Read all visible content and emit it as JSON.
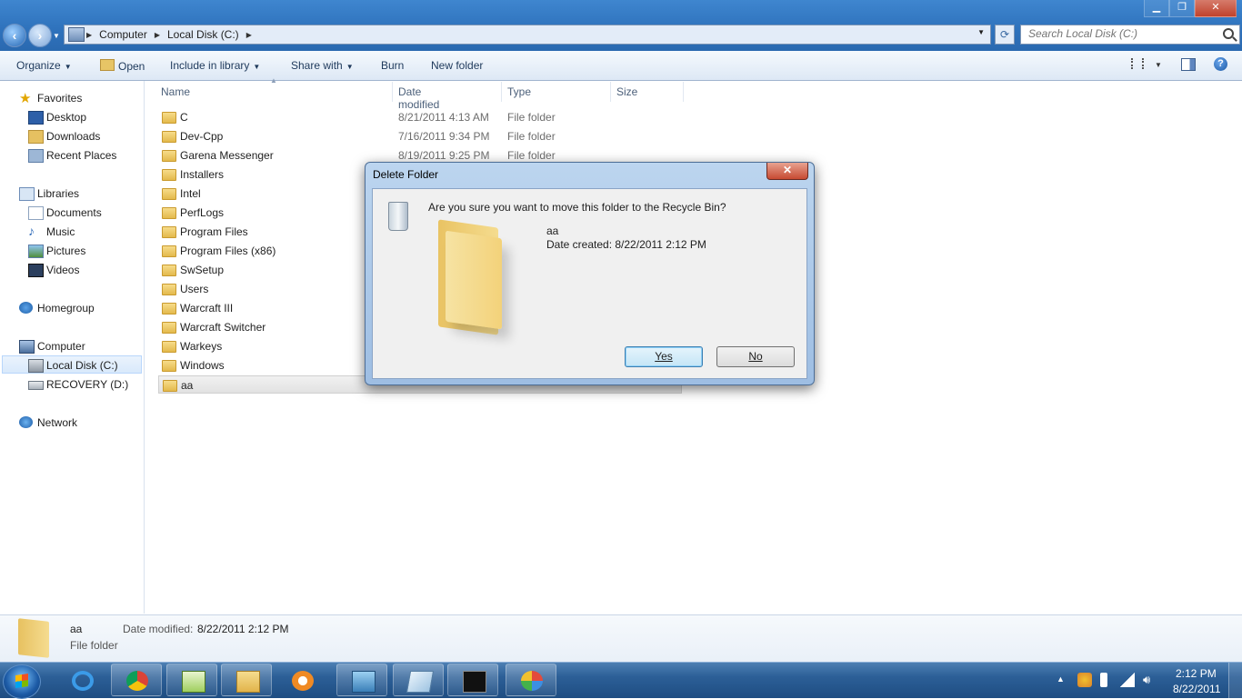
{
  "window": {
    "buttons": {
      "minimize": "▁",
      "restore": "❐",
      "close": "✕"
    },
    "breadcrumbs": [
      "Computer",
      "Local Disk (C:)"
    ],
    "search_placeholder": "Search Local Disk (C:)"
  },
  "toolbar": {
    "organize": "Organize",
    "open": "Open",
    "include": "Include in library",
    "share": "Share with",
    "burn": "Burn",
    "new_folder": "New folder"
  },
  "nav": {
    "favorites": "Favorites",
    "desktop": "Desktop",
    "downloads": "Downloads",
    "recent": "Recent Places",
    "libraries": "Libraries",
    "documents": "Documents",
    "music": "Music",
    "pictures": "Pictures",
    "videos": "Videos",
    "homegroup": "Homegroup",
    "computer": "Computer",
    "local_disk": "Local Disk (C:)",
    "recovery": "RECOVERY (D:)",
    "network": "Network"
  },
  "columns": {
    "name": "Name",
    "date": "Date modified",
    "type": "Type",
    "size": "Size"
  },
  "files": [
    {
      "name": "C",
      "date": "8/21/2011 4:13 AM",
      "type": "File folder"
    },
    {
      "name": "Dev-Cpp",
      "date": "7/16/2011 9:34 PM",
      "type": "File folder"
    },
    {
      "name": "Garena Messenger",
      "date": "8/19/2011 9:25 PM",
      "type": "File folder"
    },
    {
      "name": "Installers",
      "date": "",
      "type": ""
    },
    {
      "name": "Intel",
      "date": "",
      "type": ""
    },
    {
      "name": "PerfLogs",
      "date": "",
      "type": ""
    },
    {
      "name": "Program Files",
      "date": "",
      "type": ""
    },
    {
      "name": "Program Files (x86)",
      "date": "",
      "type": ""
    },
    {
      "name": "SwSetup",
      "date": "",
      "type": ""
    },
    {
      "name": "Users",
      "date": "",
      "type": ""
    },
    {
      "name": "Warcraft III",
      "date": "",
      "type": ""
    },
    {
      "name": "Warcraft Switcher",
      "date": "",
      "type": ""
    },
    {
      "name": "Warkeys",
      "date": "",
      "type": ""
    },
    {
      "name": "Windows",
      "date": "",
      "type": ""
    },
    {
      "name": "aa",
      "date": "",
      "type": ""
    }
  ],
  "dialog": {
    "title": "Delete Folder",
    "close": "✕",
    "message": "Are you sure you want to move this folder to the Recycle Bin?",
    "item_name": "aa",
    "item_date": "Date created: 8/22/2011 2:12 PM",
    "yes": "Yes",
    "no": "No"
  },
  "details": {
    "name": "aa",
    "type": "File folder",
    "modified_label": "Date modified:",
    "modified_value": "8/22/2011 2:12 PM"
  },
  "taskbar": {
    "time": "2:12 PM",
    "date": "8/22/2011",
    "tray_arrow": "▲"
  }
}
